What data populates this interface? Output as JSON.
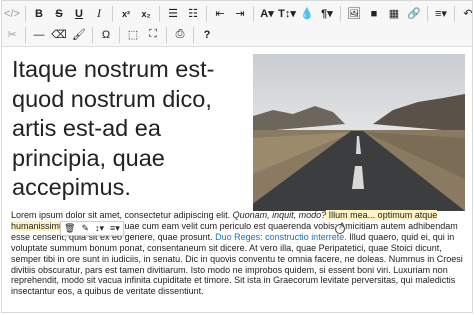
{
  "toolbar": {
    "row1": [
      {
        "name": "view-source-icon",
        "glyph": "</>",
        "cls": "dim"
      },
      {
        "name": "sep"
      },
      {
        "name": "bold-button",
        "glyph": "B",
        "cls": "b"
      },
      {
        "name": "strikethrough-button",
        "glyph": "S",
        "cls": "s"
      },
      {
        "name": "underline-button",
        "glyph": "U",
        "cls": "u"
      },
      {
        "name": "italic-button",
        "glyph": "I",
        "cls": "i"
      },
      {
        "name": "sep"
      },
      {
        "name": "superscript-button",
        "glyph": "x²",
        "cls": "sup"
      },
      {
        "name": "subscript-button",
        "glyph": "x₂",
        "cls": "sup"
      },
      {
        "name": "sep"
      },
      {
        "name": "unordered-list-icon",
        "glyph": "☰"
      },
      {
        "name": "ordered-list-icon",
        "glyph": "☷"
      },
      {
        "name": "sep"
      },
      {
        "name": "outdent-icon",
        "glyph": "⇤"
      },
      {
        "name": "indent-icon",
        "glyph": "⇥"
      },
      {
        "name": "sep"
      },
      {
        "name": "font-color-button",
        "glyph": "A▾",
        "cls": "b"
      },
      {
        "name": "font-size-button",
        "glyph": "T↕▾",
        "cls": "b"
      },
      {
        "name": "text-color-icon",
        "glyph": "💧"
      },
      {
        "name": "paragraph-button",
        "glyph": "¶▾",
        "cls": "b"
      },
      {
        "name": "sep"
      },
      {
        "name": "image-icon",
        "glyph": "🖼"
      },
      {
        "name": "video-icon",
        "glyph": "■"
      },
      {
        "name": "table-icon",
        "glyph": "▦"
      },
      {
        "name": "link-icon",
        "glyph": "🔗"
      },
      {
        "name": "sep"
      },
      {
        "name": "align-icon",
        "glyph": "≡▾"
      },
      {
        "name": "sep"
      },
      {
        "name": "undo-icon",
        "glyph": "↶"
      },
      {
        "name": "redo-icon",
        "glyph": "↷"
      }
    ],
    "row2": [
      {
        "name": "cut-icon",
        "glyph": "✂",
        "cls": "dim"
      },
      {
        "name": "sep"
      },
      {
        "name": "horizontal-rule-icon",
        "glyph": "—"
      },
      {
        "name": "eraser-icon",
        "glyph": "⌫"
      },
      {
        "name": "paint-format-icon",
        "glyph": "🖌"
      },
      {
        "name": "sep"
      },
      {
        "name": "special-char-icon",
        "glyph": "Ω"
      },
      {
        "name": "sep"
      },
      {
        "name": "select-all-icon",
        "glyph": "⬚"
      },
      {
        "name": "fullscreen-icon",
        "glyph": "⛶"
      },
      {
        "name": "sep"
      },
      {
        "name": "print-icon",
        "glyph": "⎙"
      },
      {
        "name": "sep"
      },
      {
        "name": "help-icon",
        "glyph": "?",
        "cls": "b"
      }
    ]
  },
  "content": {
    "heading": "Itaque nostrum est-quod nostrum dico, artis est-ad ea principia, quae accepimus.",
    "para_start": "Lorem ipsum dolor sit amet, consectetur adipiscing elit. ",
    "para_em": "Quonam, inquit, modo?",
    "para_hl": " Illum mea... optimum atque humanissimum virum, Cn.",
    "para_mid": " Quae cum eam velit cum periculo est quaerenda vobis; Amicitiam autem adhibendam esse censent, quia sit ex eo genere, quae prosunt. ",
    "para_link": "Duo Reges: constructio interrete.",
    "para_end": " Illud quaero, quid ei, qui in voluptate summum bonum ponat, consentaneum sit dicere. At vero illa, quae Peripatetici, quae Stoici dicunt, semper tibi in ore sunt in iudiciis, in senatu. Dic in quovis conventu te omnia facere, ne doleas. Nummus in Croesi divitiis obscuratur, pars est tamen divitiarum. Isto modo ne improbos quidem, si essent boni viri. Luxuriam non reprehendit, modo sit vacua infinita cupiditate et timore. Sit ista in Graecorum levitate perversitas, qui maledictis insectantur eos, a quibus de veritate dissentiunt."
  },
  "image_toolbar": {
    "items": [
      {
        "name": "image-delete-icon",
        "glyph": "🗑"
      },
      {
        "name": "image-edit-icon",
        "glyph": "✎"
      },
      {
        "name": "image-resize-icon",
        "glyph": "↕▾"
      },
      {
        "name": "image-align-icon",
        "glyph": "≡▾"
      }
    ]
  },
  "colors": {
    "link": "#1a6fc9",
    "highlight": "#fff4c2",
    "toolbar_bg": "#f7f7f7"
  }
}
